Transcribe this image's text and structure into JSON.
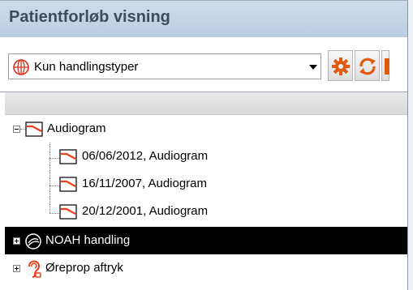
{
  "window": {
    "title": "Patientforløb visning"
  },
  "filter": {
    "selected": "Kun handlingstyper",
    "icon": "globe-icon"
  },
  "toolbar": {
    "buttons": [
      "gear-icon",
      "refresh-icon",
      "partial-button"
    ]
  },
  "tree": {
    "audiogram": {
      "label": "Audiogram",
      "icon": "audiogram-icon",
      "expanded": true,
      "children": [
        {
          "label": "06/06/2012, Audiogram"
        },
        {
          "label": "16/11/2007, Audiogram"
        },
        {
          "label": "20/12/2001, Audiogram"
        }
      ]
    },
    "noah": {
      "label": "NOAH handling",
      "icon": "noah-icon",
      "selected": true
    },
    "earprint": {
      "label": "Øreprop aftryk",
      "icon": "ear-icon"
    }
  },
  "colors": {
    "accent": "#e8411a",
    "selection": "#000000",
    "title_bg": "#c6d4e8"
  }
}
